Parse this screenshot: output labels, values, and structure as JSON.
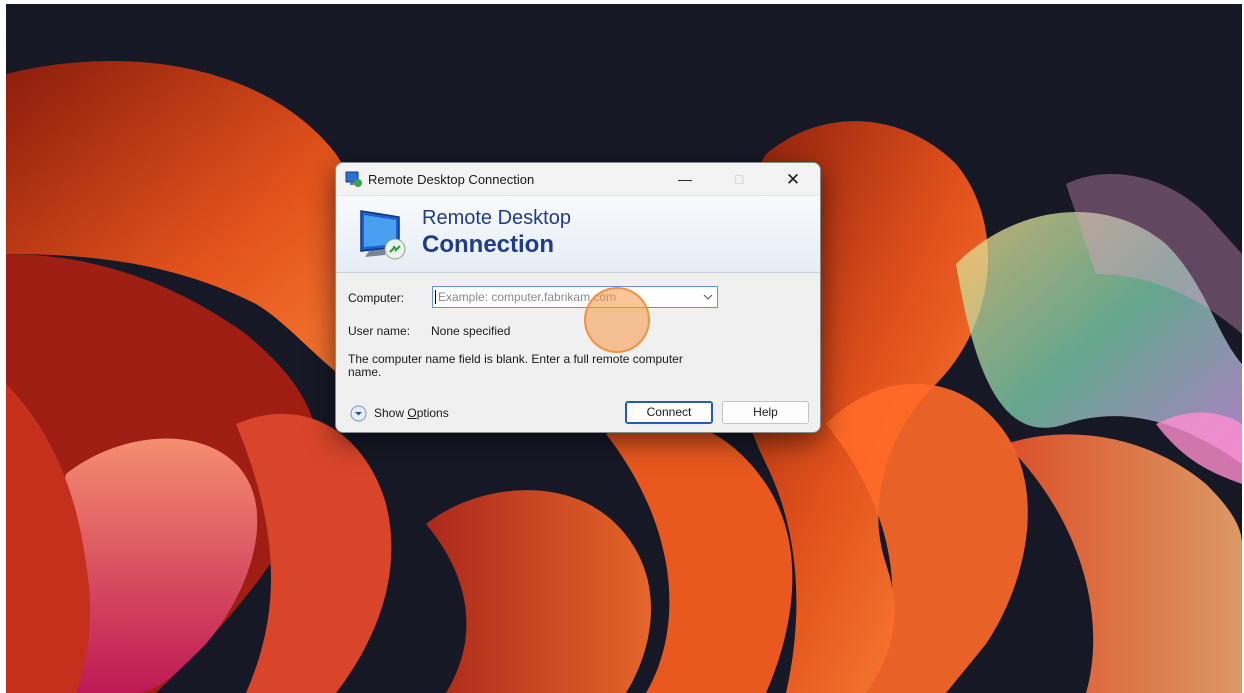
{
  "window": {
    "title": "Remote Desktop Connection",
    "minimize_glyph": "—",
    "maximize_glyph": "□",
    "close_glyph": "✕"
  },
  "banner": {
    "line1": "Remote Desktop",
    "line2": "Connection"
  },
  "form": {
    "computer_label": "Computer:",
    "computer_placeholder": "Example: computer.fabrikam.com",
    "computer_value": "",
    "username_label": "User name:",
    "username_value": "None specified",
    "message": "The computer name field is blank. Enter a full remote computer name."
  },
  "footer": {
    "show_options_prefix": "Show ",
    "show_options_accel": "O",
    "show_options_rest": "ptions",
    "connect_label": "Connect",
    "help_label": "Help"
  },
  "icons": {
    "app_icon": "remote-desktop-icon",
    "options_icon": "chevron-down-circle-icon",
    "dropdown_icon": "chevron-down-icon"
  },
  "colors": {
    "accent": "#1a5fb4",
    "banner_text": "#1f3c8a",
    "click_indicator": "#f59646"
  }
}
